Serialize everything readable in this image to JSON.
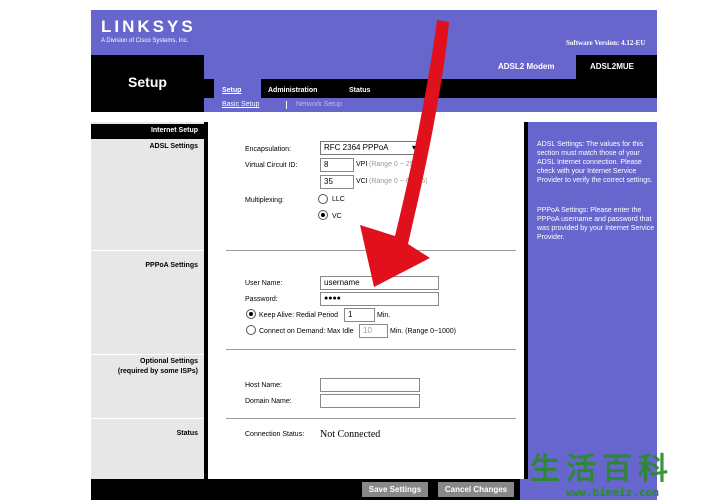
{
  "header": {
    "brand": "LINKSYS",
    "brand_sub": "A Division of Cisco Systems, Inc.",
    "software_version": "Software Version: 4.12-EU"
  },
  "band": {
    "section_title": "Setup",
    "product_name": "ADSL2 Modem",
    "model": "ADSL2MUE",
    "tabs": [
      "Setup",
      "Administration",
      "Status"
    ],
    "subtabs": [
      "Basic Setup",
      "Network Setup"
    ]
  },
  "left": {
    "internet_setup": "Internet Setup",
    "adsl_settings": "ADSL Settings",
    "pppoa_settings": "PPPoA Settings",
    "optional_settings": "Optional Settings",
    "optional_settings_note": "(required by some ISPs)",
    "status": "Status"
  },
  "form": {
    "encapsulation_label": "Encapsulation:",
    "encapsulation_value": "RFC 2364 PPPoA",
    "vc_id_label": "Virtual Circuit ID:",
    "vpi_value": "8",
    "vpi_label": "VPI",
    "vpi_hint": "(Range 0 ~ 255)",
    "vci_value": "35",
    "vci_label": "VCI",
    "vci_hint": "(Range 0 ~ 65535)",
    "multiplexing_label": "Multiplexing:",
    "mux_llc": "LLC",
    "mux_vc": "VC",
    "user_name_label": "User Name:",
    "user_name_value": "username",
    "password_label": "Password:",
    "password_value": "●●●●",
    "keep_alive_label": "Keep Alive: Redial Period",
    "redial_period": "1",
    "min_label": "Min.",
    "connect_on_demand_label": "Connect on Demand: Max Idle",
    "max_idle": "10",
    "max_idle_hint": "Min. (Range 0~1000)",
    "host_name_label": "Host Name:",
    "domain_name_label": "Domain Name:",
    "connection_status_label": "Connection Status:",
    "connection_status_value": "Not Connected"
  },
  "help": {
    "adsl": "ADSL Settings: The values for this section must match those of your ADSL Internet connection. Please check with your Internet Service Provider to verify the correct settings.",
    "pppoa": "PPPoA Settings: Please enter the PPPoA username and password that was provided by your Internet Service Provider."
  },
  "footer": {
    "save": "Save Settings",
    "cancel": "Cancel Changes"
  },
  "watermark": {
    "url": "www.bimeiz.com"
  },
  "colors": {
    "brand_purple": "#6666cc",
    "arrow_red": "#e0101c"
  }
}
